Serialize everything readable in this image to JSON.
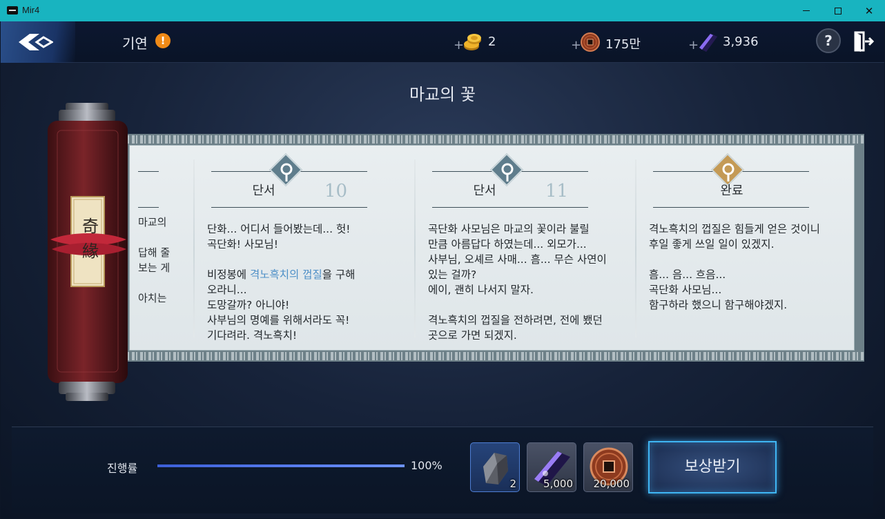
{
  "window": {
    "title": "Mir4",
    "minimize": "—",
    "maximize": "☐",
    "close": "✕"
  },
  "header": {
    "section_title": "기연",
    "alert_badge": "!",
    "currencies": [
      {
        "icon": "gold-coin-icon",
        "plus": "+",
        "value": "2"
      },
      {
        "icon": "copper-coin-icon",
        "plus": "+",
        "value": "175만"
      },
      {
        "icon": "darksteel-icon",
        "plus": "+",
        "value": "3,936"
      }
    ],
    "help_label": "?"
  },
  "quest": {
    "title": "마교의 꽃",
    "cut_column": {
      "lines": [
        "마교의",
        "답해 줄",
        "보는 게",
        "아치는"
      ]
    },
    "entries": [
      {
        "type": "단서",
        "number": "10",
        "marker": "blue",
        "lines": [
          [
            {
              "t": "단화... 어디서 들어봤는데... 헛!"
            }
          ],
          [
            {
              "t": "곡단화! 사모님!"
            }
          ],
          [
            {
              "t": ""
            }
          ],
          [
            {
              "t": "비정봉에 "
            },
            {
              "t": "격노흑치의 껍질",
              "hl": true
            },
            {
              "t": "을 구해"
            }
          ],
          [
            {
              "t": "오라니..."
            }
          ],
          [
            {
              "t": "도망갈까? 아니야!"
            }
          ],
          [
            {
              "t": "사부님의 명예를 위해서라도 꼭!"
            }
          ],
          [
            {
              "t": "기다려라. 격노흑치!"
            }
          ]
        ]
      },
      {
        "type": "단서",
        "number": "11",
        "marker": "blue",
        "lines": [
          [
            {
              "t": "곡단화 사모님은 마교의 꽃이라 불릴"
            }
          ],
          [
            {
              "t": "만큼 아름답다 하였는데... 외모가..."
            }
          ],
          [
            {
              "t": "사부님, 오셰르 사매... 흠... 무슨 사연이"
            }
          ],
          [
            {
              "t": "있는 걸까?"
            }
          ],
          [
            {
              "t": "에이, 괜히 나서지 말자."
            }
          ],
          [
            {
              "t": ""
            }
          ],
          [
            {
              "t": "격노흑치의 껍질을 전하려면, 전에 뵀던"
            }
          ],
          [
            {
              "t": "곳으로 가면 되겠지."
            }
          ]
        ]
      },
      {
        "type": "완료",
        "number": "",
        "marker": "gold",
        "lines": [
          [
            {
              "t": "격노흑치의 껍질은 힘들게 얻은 것이니"
            }
          ],
          [
            {
              "t": "후일 좋게 쓰일 일이 있겠지."
            }
          ],
          [
            {
              "t": ""
            }
          ],
          [
            {
              "t": "흠... 음... 흐음..."
            }
          ],
          [
            {
              "t": "곡단화 사모님..."
            }
          ],
          [
            {
              "t": "함구하라 했으니 함구해야겠지."
            }
          ]
        ]
      }
    ],
    "scroll_seal": [
      "奇",
      "緣"
    ]
  },
  "progress": {
    "label": "진행률",
    "value": 1.0,
    "percent_text": "100%"
  },
  "rewards": [
    {
      "icon": "gray-stone-icon",
      "count": "2",
      "selected": true
    },
    {
      "icon": "darksteel-icon",
      "count": "5,000",
      "selected": false
    },
    {
      "icon": "copper-coin-icon",
      "count": "20,000",
      "selected": false
    }
  ],
  "claim_button": "보상받기",
  "colors": {
    "titlebar": "#18b4c0",
    "highlight_text": "#4d8fc7",
    "alert": "#f08a17",
    "claim_border": "#3fb6f4"
  }
}
